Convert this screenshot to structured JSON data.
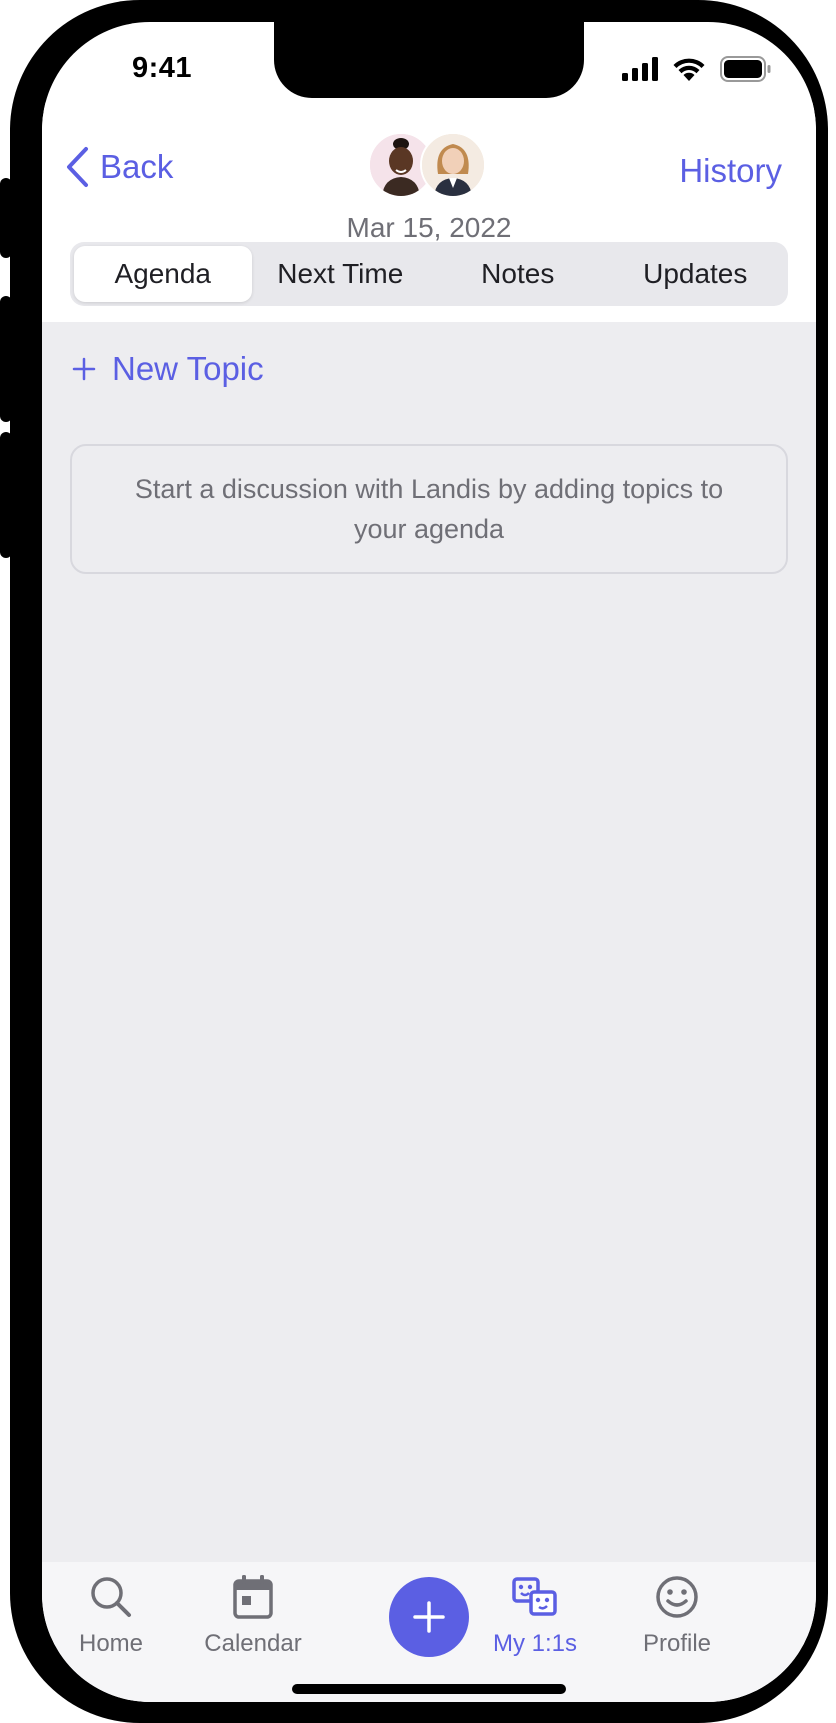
{
  "status_bar": {
    "time": "9:41"
  },
  "header": {
    "back_label": "Back",
    "history_label": "History",
    "date": "Mar 15, 2022"
  },
  "tabs": [
    {
      "label": "Agenda",
      "active": true
    },
    {
      "label": "Next Time",
      "active": false
    },
    {
      "label": "Notes",
      "active": false
    },
    {
      "label": "Updates",
      "active": false
    }
  ],
  "content": {
    "new_topic_label": "New Topic",
    "empty_message": "Start a discussion with Landis by adding topics to your agenda"
  },
  "tabbar": {
    "items": [
      {
        "label": "Home",
        "icon": "search-icon"
      },
      {
        "label": "Calendar",
        "icon": "calendar-icon"
      },
      {
        "label": "",
        "icon": "plus-icon"
      },
      {
        "label": "My 1:1s",
        "icon": "one-on-one-icon",
        "active": true
      },
      {
        "label": "Profile",
        "icon": "smiley-icon"
      }
    ]
  },
  "colors": {
    "accent": "#5b5fe3",
    "content_bg": "#ededf0",
    "text_muted": "#6f6f76"
  }
}
